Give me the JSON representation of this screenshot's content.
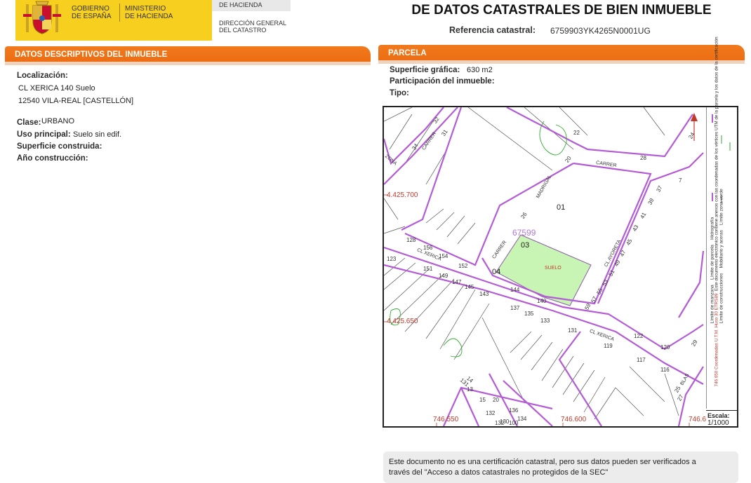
{
  "header": {
    "gov_line1": "GOBIERNO",
    "gov_line2": "DE ESPAÑA",
    "min_line1": "MINISTERIO",
    "min_line2": "DE HACIENDA",
    "sub_top": "DE HACIENDA",
    "dg_line1": "DIRECCIÓN GENERAL",
    "dg_line2": "DEL CATASTRO",
    "title": "DE DATOS CATASTRALES DE BIEN INMUEBLE",
    "ref_label": "Referencia catastral:",
    "ref_value": "6759903YK4265N0001UG"
  },
  "left": {
    "section_title": "DATOS DESCRIPTIVOS DEL INMUEBLE",
    "localizacion_label": "Localización:",
    "address_line1": "CL XERICA 140 Suelo",
    "address_line2": "12540 VILA-REAL [CASTELLÓN]",
    "clase_label": "Clase:",
    "clase_value": "URBANO",
    "uso_label": "Uso principal:",
    "uso_value": "Suelo sin edif.",
    "superficie_label": "Superficie construida:",
    "anio_label": "Año construcción:"
  },
  "right": {
    "section_title": "PARCELA",
    "sup_label": "Superficie gráfica:",
    "sup_value": "630 m2",
    "part_label": "Participación del inmueble:",
    "tipo_label": "Tipo:"
  },
  "map": {
    "coord_y1": "4.425.700",
    "coord_y2": "4.425.650",
    "coord_x1": "746.550",
    "coord_x2": "746.600",
    "coord_x3": "746.6",
    "parcel_id": "67599",
    "parcel_label": "SUELO",
    "sub_01": "01",
    "sub_03": "03",
    "sub_04": "04",
    "street_xerica_1": "CL XERICA",
    "street_xerica_2": "CL XERICA",
    "street_carrer_1": "CARRER",
    "street_carrer_2": "CARRER",
    "street_carrer_3": "CARRER",
    "street_madrigal": "MADRIGAL",
    "street_ayoreta": "CL AYORETA",
    "street_blas": "BLAS",
    "street_zona": "ZONA",
    "numbers": [
      "32",
      "34",
      "31",
      "24",
      "22",
      "20",
      "28",
      "7",
      "37",
      "39",
      "41",
      "43",
      "45",
      "47",
      "49",
      "51",
      "53",
      "55",
      "57",
      "59",
      "26",
      "128",
      "156",
      "154",
      "152",
      "123",
      "151",
      "149",
      "147",
      "145",
      "143",
      "144",
      "140",
      "137",
      "135",
      "133",
      "131",
      "119",
      "122",
      "120",
      "117",
      "116",
      "29",
      "27",
      "25",
      "14",
      "13",
      "15",
      "20",
      "132",
      "130",
      "136",
      "134",
      "131",
      "132",
      "100"
    ],
    "legend_1": "Límite de manzana",
    "legend_2": "Límite de parcela",
    "legend_3": "Hidrografía",
    "legend_4": "Límite de construcciones",
    "legend_5": "Mobiliario y aceras",
    "legend_6": "Límite zona verde",
    "legend_coords": "746.650 Coordenadas U.T.M. Huso 30 ETRS89",
    "legend_note": "Este documento electrónico contiene anexos con las coordenadas de los vértices UTM de la parcela y los datos de la certificación",
    "scale_label": "Escala:",
    "scale_value": "1/1000"
  },
  "notice": {
    "line1": "Este documento no es una certificación catastral, pero sus datos pueden ser verificados a",
    "line2": "través del \"Acceso a datos catastrales no protegidos de la SEC\""
  },
  "colors": {
    "orange": "#ee6d12",
    "yellow": "#f6cf1f",
    "block_line": "#b45bd6",
    "parcel_fill": "#c8f5b4"
  }
}
